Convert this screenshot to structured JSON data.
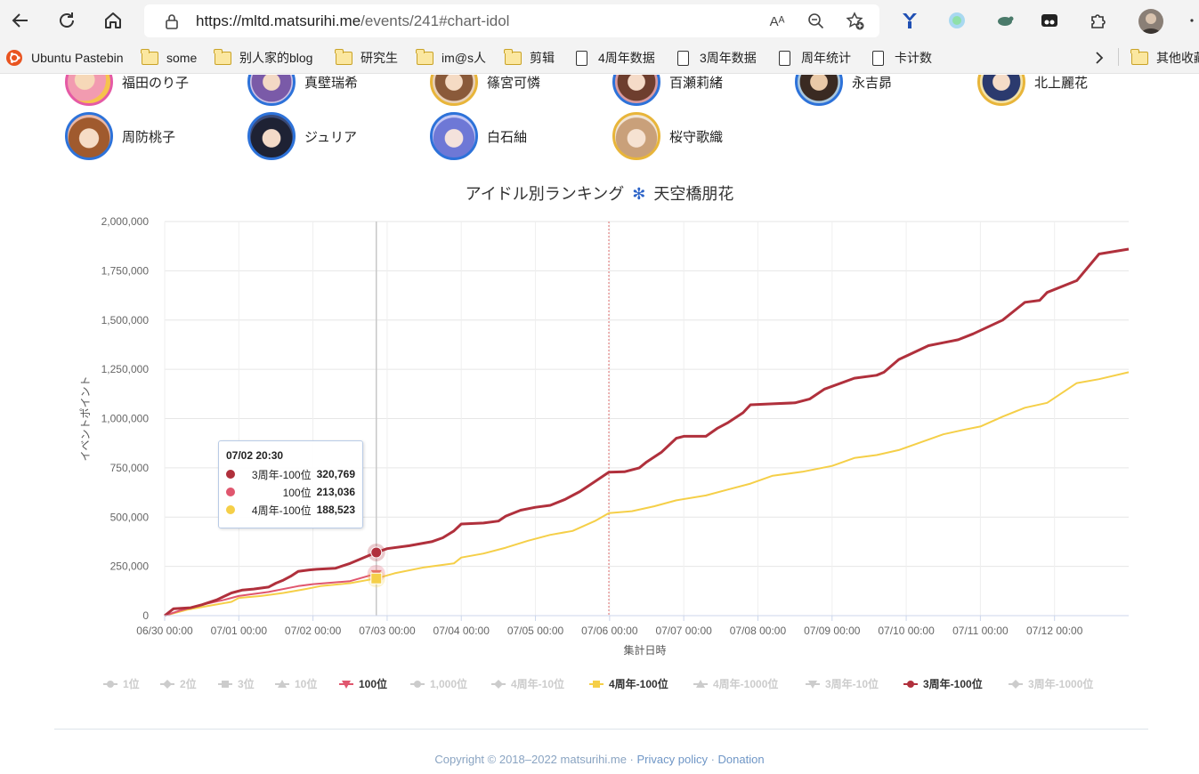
{
  "browser": {
    "url_host": "https://mltd.matsurihi.me",
    "url_path": "/events/241#chart-idol",
    "read_aloud_label": "Aᴬ"
  },
  "bookmarks": [
    {
      "label": "Ubuntu Pastebin",
      "icon": "ubuntu-icon"
    },
    {
      "label": "some",
      "icon": "folder-icon"
    },
    {
      "label": "别人家的blog",
      "icon": "folder-icon"
    },
    {
      "label": "研究生",
      "icon": "folder-icon"
    },
    {
      "label": "im@s人",
      "icon": "folder-icon"
    },
    {
      "label": "剪辑",
      "icon": "folder-icon"
    },
    {
      "label": "4周年数据",
      "icon": "document-icon"
    },
    {
      "label": "3周年数据",
      "icon": "document-icon"
    },
    {
      "label": "周年统计",
      "icon": "document-icon"
    },
    {
      "label": "卡计数",
      "icon": "document-icon"
    },
    {
      "label": "其他收藏",
      "icon": "folder-icon"
    }
  ],
  "idols": {
    "row1": [
      "福田のり子",
      "真壁瑞希",
      "篠宮可憐",
      "百瀬莉緒",
      "永吉昴",
      "北上麗花"
    ],
    "row2": [
      "周防桃子",
      "ジュリア",
      "白石紬",
      "桜守歌織"
    ]
  },
  "chart_title": {
    "main": "アイドル別ランキング",
    "separator": "✻",
    "idol": "天空橋朋花"
  },
  "tooltip": {
    "time": "07/02 20:30",
    "rows": [
      {
        "name": "3周年-100位",
        "value": "320,769",
        "color": "#b0303c"
      },
      {
        "name": "100位",
        "value": "213,036",
        "color": "#e0566e"
      },
      {
        "name": "4周年-100位",
        "value": "188,523",
        "color": "#f5cf48"
      }
    ]
  },
  "legend": [
    {
      "label": "1位",
      "active": false,
      "marker": "circle"
    },
    {
      "label": "2位",
      "active": false,
      "marker": "diamond"
    },
    {
      "label": "3位",
      "active": false,
      "marker": "square"
    },
    {
      "label": "10位",
      "active": false,
      "marker": "triangle"
    },
    {
      "label": "100位",
      "active": true,
      "marker": "triangle-down",
      "color": "#e0566e"
    },
    {
      "label": "1,000位",
      "active": false,
      "marker": "circle"
    },
    {
      "label": "4周年-10位",
      "active": false,
      "marker": "diamond"
    },
    {
      "label": "4周年-100位",
      "active": true,
      "marker": "square",
      "color": "#f5cf48"
    },
    {
      "label": "4周年-1000位",
      "active": false,
      "marker": "triangle"
    },
    {
      "label": "3周年-10位",
      "active": false,
      "marker": "triangle-down"
    },
    {
      "label": "3周年-100位",
      "active": true,
      "marker": "circle",
      "color": "#b0303c"
    },
    {
      "label": "3周年-1000位",
      "active": false,
      "marker": "diamond"
    }
  ],
  "footer": {
    "copyright": "Copyright © 2018–2022 matsurihi.me",
    "separator": " · ",
    "privacy": "Privacy policy",
    "donation": "Donation"
  },
  "chart_data": {
    "type": "line",
    "title": "アイドル別ランキング ✻ 天空橋朋花",
    "xlabel": "集計日時",
    "ylabel": "イベントポイント",
    "x_unit": "days since 06/30 00:00",
    "xticks": [
      "06/30 00:00",
      "07/01 00:00",
      "07/02 00:00",
      "07/03 00:00",
      "07/04 00:00",
      "07/05 00:00",
      "07/06 00:00",
      "07/07 00:00",
      "07/08 00:00",
      "07/09 00:00",
      "07/10 00:00",
      "07/11 00:00",
      "07/12 00:00"
    ],
    "yticks": [
      "0",
      "250,000",
      "500,000",
      "750,000",
      "1,000,000",
      "1,250,000",
      "1,500,000",
      "1,750,000",
      "2,000,000"
    ],
    "xlim": [
      0,
      13
    ],
    "ylim": [
      0,
      2000000
    ],
    "grid": true,
    "legend_position": "bottom",
    "crosshair_x": 2.854,
    "event_marker_x": 5.99,
    "series": [
      {
        "name": "3周年-100位",
        "color": "#b0303c",
        "x": [
          0,
          0.12,
          0.35,
          0.5,
          0.7,
          0.9,
          1.05,
          1.2,
          1.4,
          1.5,
          1.6,
          1.7,
          1.8,
          1.95,
          2.05,
          2.3,
          2.5,
          2.854,
          3.0,
          3.3,
          3.6,
          3.75,
          3.9,
          4.0,
          4.3,
          4.5,
          4.6,
          4.8,
          5.0,
          5.2,
          5.4,
          5.6,
          5.8,
          5.99,
          6.2,
          6.4,
          6.5,
          6.7,
          6.9,
          7.0,
          7.3,
          7.45,
          7.6,
          7.8,
          7.9,
          8.2,
          8.5,
          8.7,
          8.9,
          9.3,
          9.6,
          9.7,
          9.9,
          10.3,
          10.5,
          10.7,
          10.9,
          11.3,
          11.5,
          11.6,
          11.8,
          11.9,
          12.3,
          12.6,
          13.0
        ],
        "y": [
          0,
          35000,
          40000,
          55000,
          80000,
          115000,
          130000,
          135000,
          145000,
          165000,
          180000,
          200000,
          225000,
          232000,
          235000,
          240000,
          265000,
          320769,
          340000,
          355000,
          375000,
          395000,
          430000,
          465000,
          470000,
          480000,
          505000,
          535000,
          550000,
          560000,
          590000,
          630000,
          680000,
          728000,
          730000,
          750000,
          780000,
          830000,
          900000,
          910000,
          910000,
          950000,
          980000,
          1030000,
          1070000,
          1075000,
          1080000,
          1100000,
          1150000,
          1205000,
          1220000,
          1235000,
          1300000,
          1370000,
          1385000,
          1400000,
          1430000,
          1500000,
          1560000,
          1590000,
          1600000,
          1640000,
          1700000,
          1835000,
          1860000
        ]
      },
      {
        "name": "100位",
        "color": "#e0566e",
        "x": [
          0,
          0.2,
          0.5,
          0.8,
          1.0,
          1.4,
          1.8,
          2.0,
          2.5,
          2.854
        ],
        "y": [
          0,
          25000,
          55000,
          80000,
          100000,
          120000,
          150000,
          160000,
          175000,
          213036
        ]
      },
      {
        "name": "4周年-100位",
        "color": "#f5cf48",
        "x": [
          0,
          0.3,
          0.6,
          0.9,
          1.0,
          1.3,
          1.6,
          1.9,
          2.1,
          2.5,
          2.854,
          3.1,
          3.5,
          3.9,
          4.0,
          4.3,
          4.6,
          4.9,
          5.2,
          5.5,
          5.8,
          5.99,
          6.3,
          6.6,
          6.9,
          7.3,
          7.6,
          7.9,
          8.2,
          8.6,
          9.0,
          9.3,
          9.6,
          9.9,
          10.2,
          10.5,
          10.8,
          11.0,
          11.3,
          11.6,
          11.9,
          12.3,
          12.6,
          13.0
        ],
        "y": [
          0,
          30000,
          50000,
          70000,
          90000,
          100000,
          115000,
          135000,
          150000,
          165000,
          188523,
          215000,
          245000,
          265000,
          295000,
          315000,
          345000,
          380000,
          410000,
          430000,
          480000,
          520000,
          530000,
          555000,
          585000,
          610000,
          640000,
          670000,
          710000,
          730000,
          760000,
          800000,
          815000,
          840000,
          880000,
          920000,
          945000,
          960000,
          1010000,
          1055000,
          1080000,
          1180000,
          1200000,
          1235000
        ]
      }
    ]
  }
}
